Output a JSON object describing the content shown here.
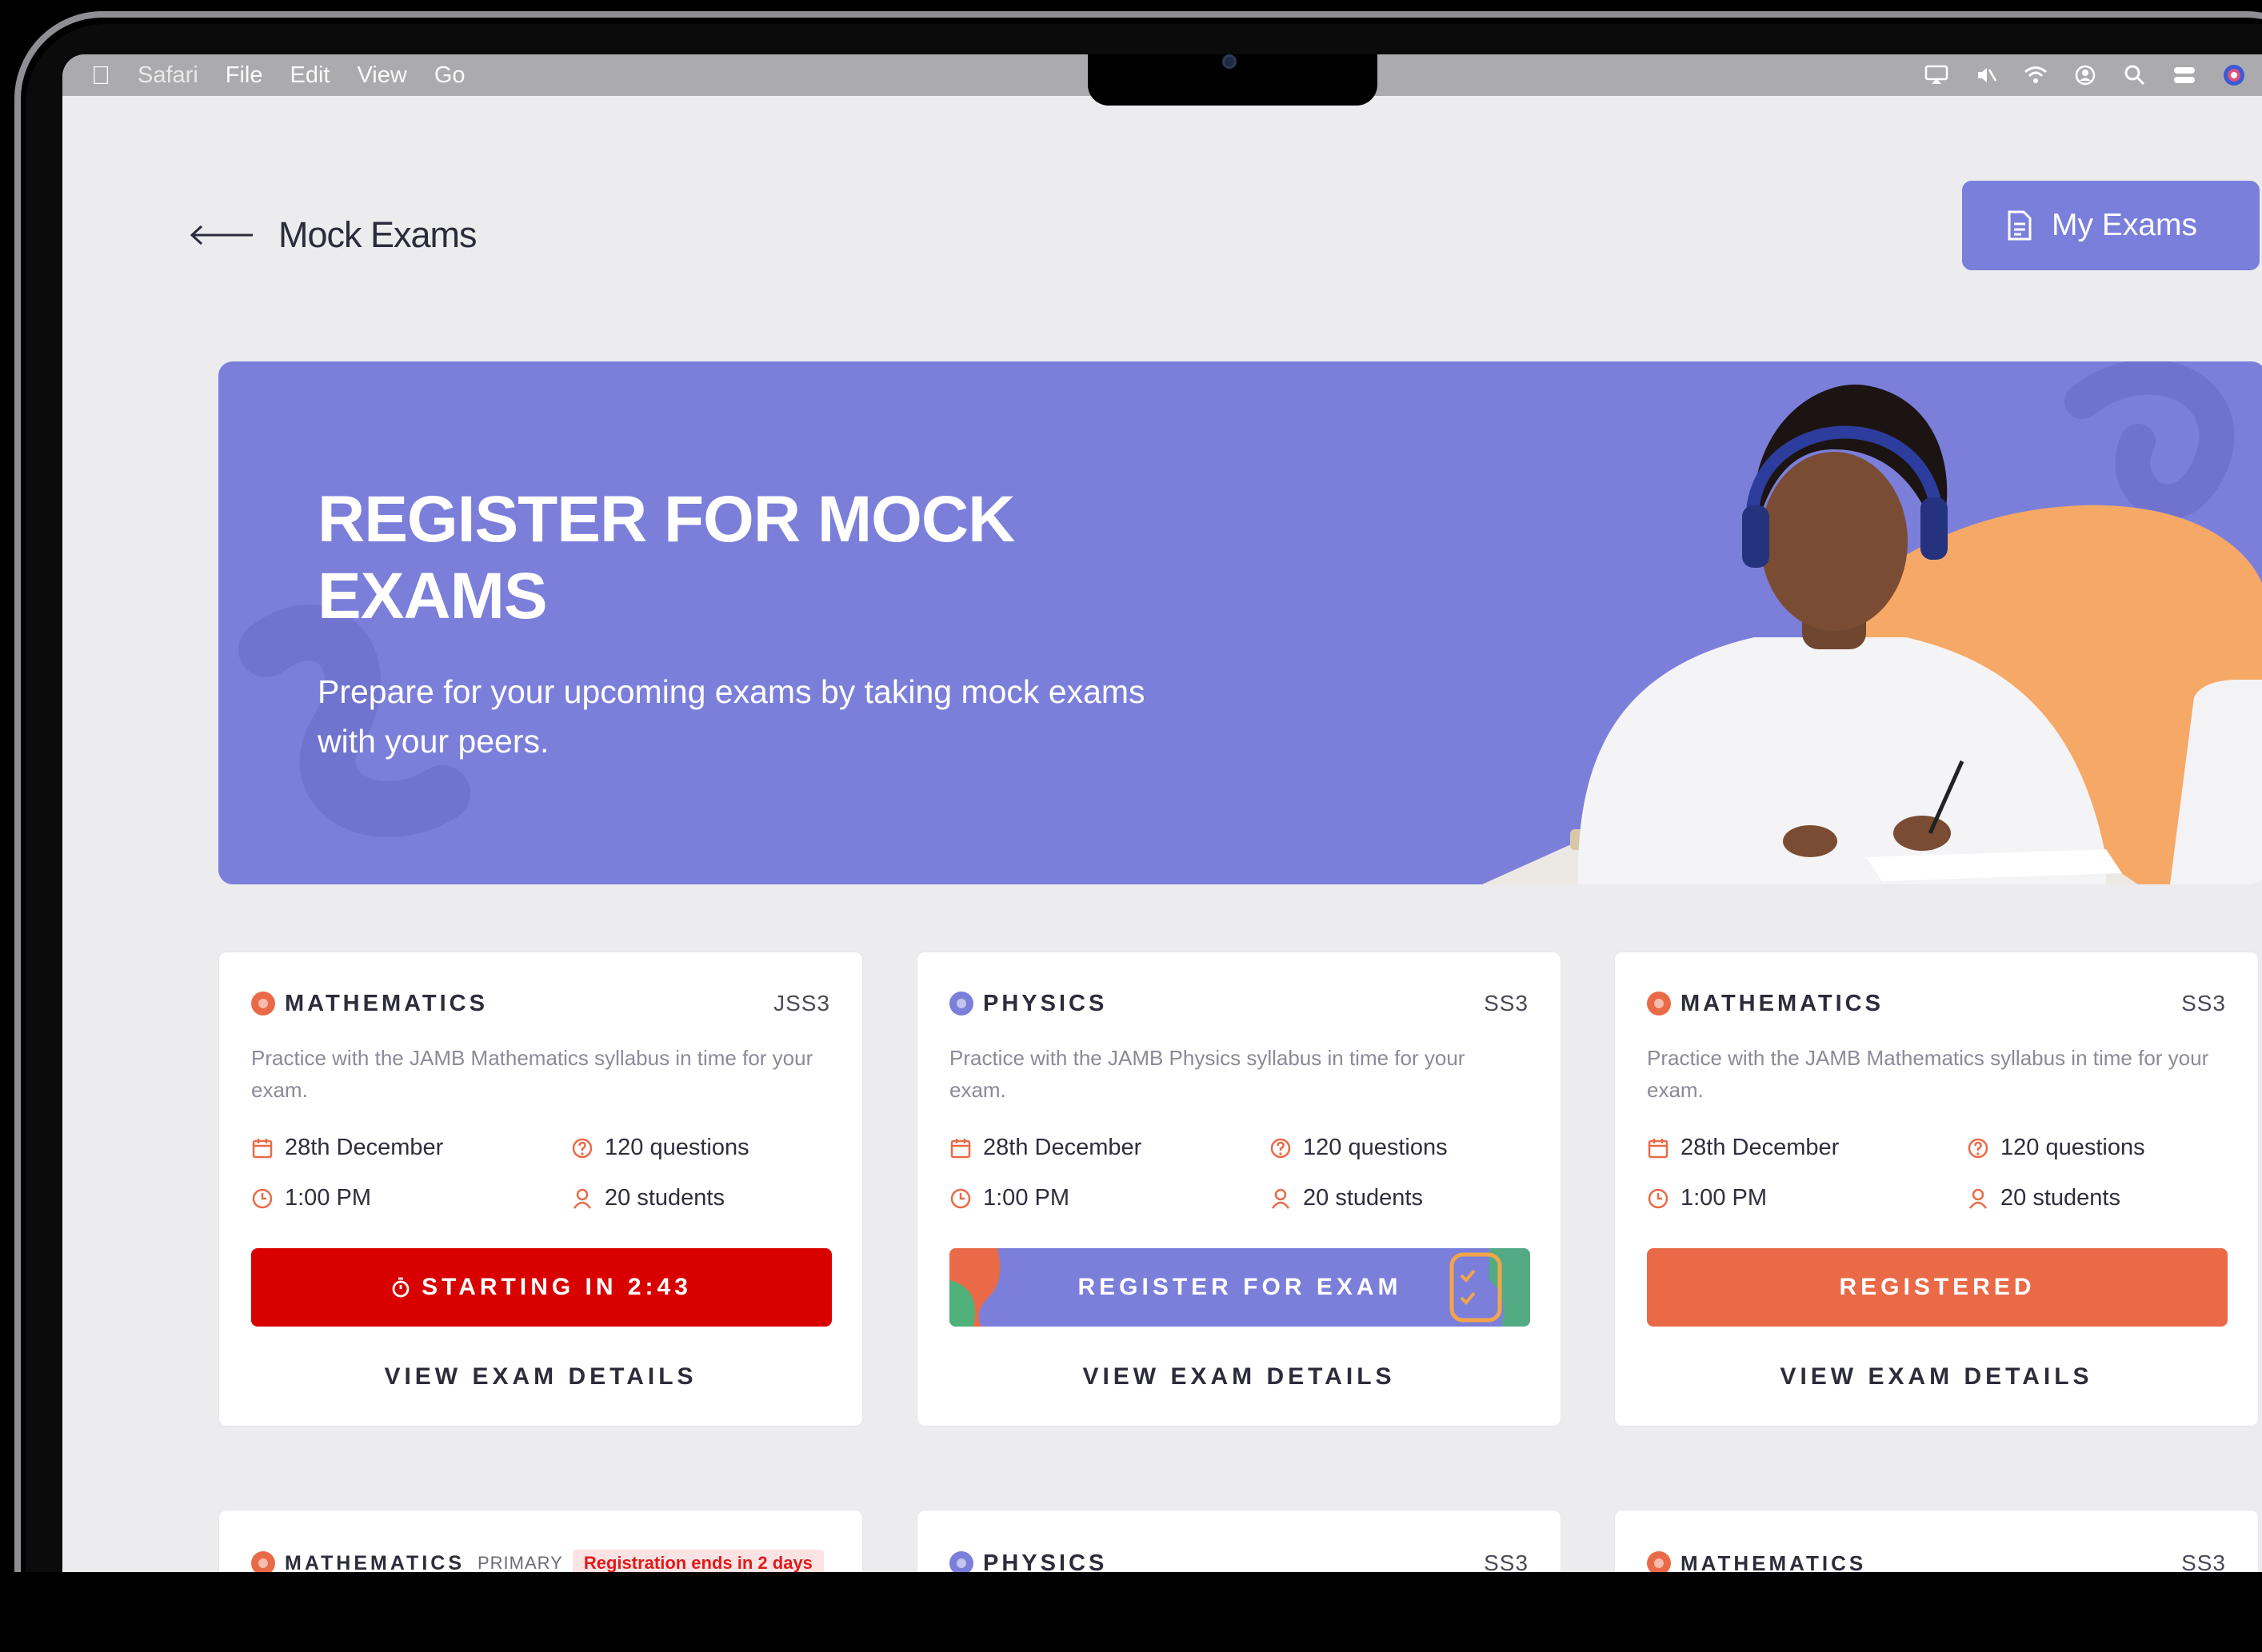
{
  "menubar": {
    "app": "Safari",
    "items": [
      "File",
      "Edit",
      "View",
      "Go"
    ]
  },
  "header": {
    "title": "Mock Exams",
    "my_exams_label": "My Exams"
  },
  "hero": {
    "title": "REGISTER FOR MOCK EXAMS",
    "subtitle": "Prepare for your upcoming exams by taking mock exams with your peers."
  },
  "colors": {
    "accent": "#7b7fda",
    "danger": "#d90000",
    "registered": "#ea6a47",
    "math": "#ea6a47",
    "physics": "#7b7fda"
  },
  "cards": [
    {
      "subject": "MATHEMATICS",
      "level": "JSS3",
      "description": "Practice with the JAMB Mathematics syllabus in time for your exam.",
      "date": "28th December",
      "questions": "120 questions",
      "time": "1:00 PM",
      "students": "20 students",
      "action": "STARTING IN 2:43",
      "details": "VIEW EXAM DETAILS"
    },
    {
      "subject": "PHYSICS",
      "level": "SS3",
      "description": "Practice with the JAMB Physics syllabus in time for your exam.",
      "date": "28th December",
      "questions": "120 questions",
      "time": "1:00 PM",
      "students": "20 students",
      "action": "REGISTER FOR EXAM",
      "details": "VIEW EXAM DETAILS"
    },
    {
      "subject": "MATHEMATICS",
      "level": "SS3",
      "description": "Practice with the JAMB Mathematics syllabus in time for your exam.",
      "date": "28th December",
      "questions": "120 questions",
      "time": "1:00 PM",
      "students": "20 students",
      "action": "REGISTERED",
      "details": "VIEW EXAM DETAILS"
    },
    {
      "subject": "MATHEMATICS",
      "level": "PRIMARY",
      "badge": "Registration ends in 2 days"
    },
    {
      "subject": "PHYSICS",
      "level": "SS3"
    },
    {
      "subject": "MATHEMATICS",
      "level": "SS3"
    }
  ]
}
